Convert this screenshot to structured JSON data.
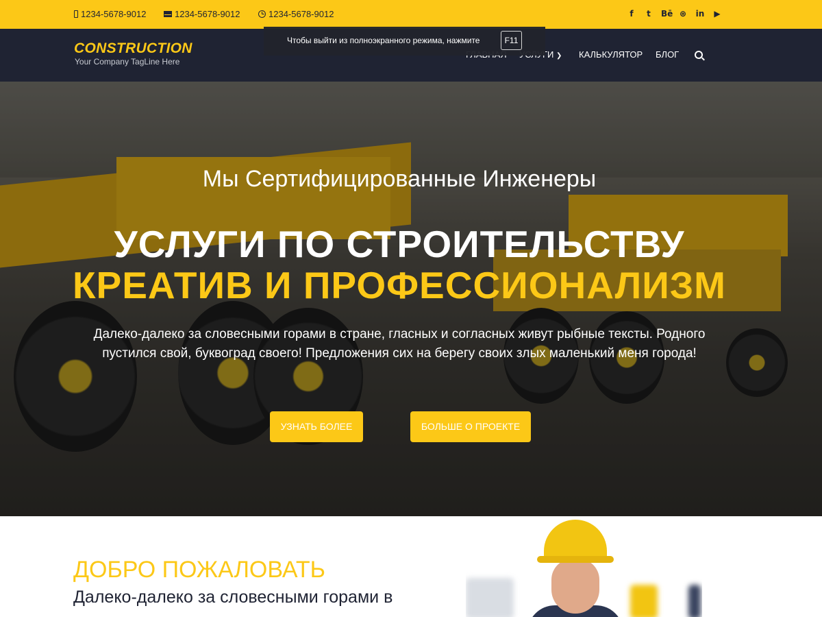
{
  "topbar": {
    "phone": "1234-5678-9012",
    "email": "1234-5678-9012",
    "hours": "1234-5678-9012",
    "social_icons": [
      "facebook-icon",
      "twitter-icon",
      "behance-icon",
      "dribbble-icon",
      "linkedin-icon",
      "youtube-icon"
    ]
  },
  "logo": {
    "name": "CONSTRUCTION",
    "tagline": "Your Company TagLine Here"
  },
  "nav": {
    "items": [
      "ГЛАВНАЯ",
      "УСЛУГИ",
      "КАЛЬКУЛЯТОР",
      "БЛОГ"
    ],
    "search_icon": "search-icon"
  },
  "fullscreen_toast": {
    "text": "Чтобы выйти из полноэкранного режима, нажмите",
    "key": "F11"
  },
  "hero": {
    "subtitle": "Мы Сертифицированные Инженеры",
    "title_line1": "УСЛУГИ ПО СТРОИТЕЛЬСТВУ",
    "title_line2": "КРЕАТИВ И ПРОФЕССИОНАЛИЗМ",
    "description": "Далеко-далеко за словесными горами в стране, гласных и согласных живут рыбные тексты. Родного пустился свой, буквоград своего! Предложения сих на берегу своих злых маленький меня города!",
    "button_more": "УЗНАТЬ БОЛЕЕ",
    "button_project": "БОЛЬШЕ О ПРОЕКТЕ"
  },
  "welcome": {
    "title": "ДОБРО ПОЖАЛОВАТЬ",
    "text": "Далеко-далеко за словесными горами в"
  },
  "colors": {
    "accent": "#fcc817",
    "header_bg": "#1f2333"
  }
}
